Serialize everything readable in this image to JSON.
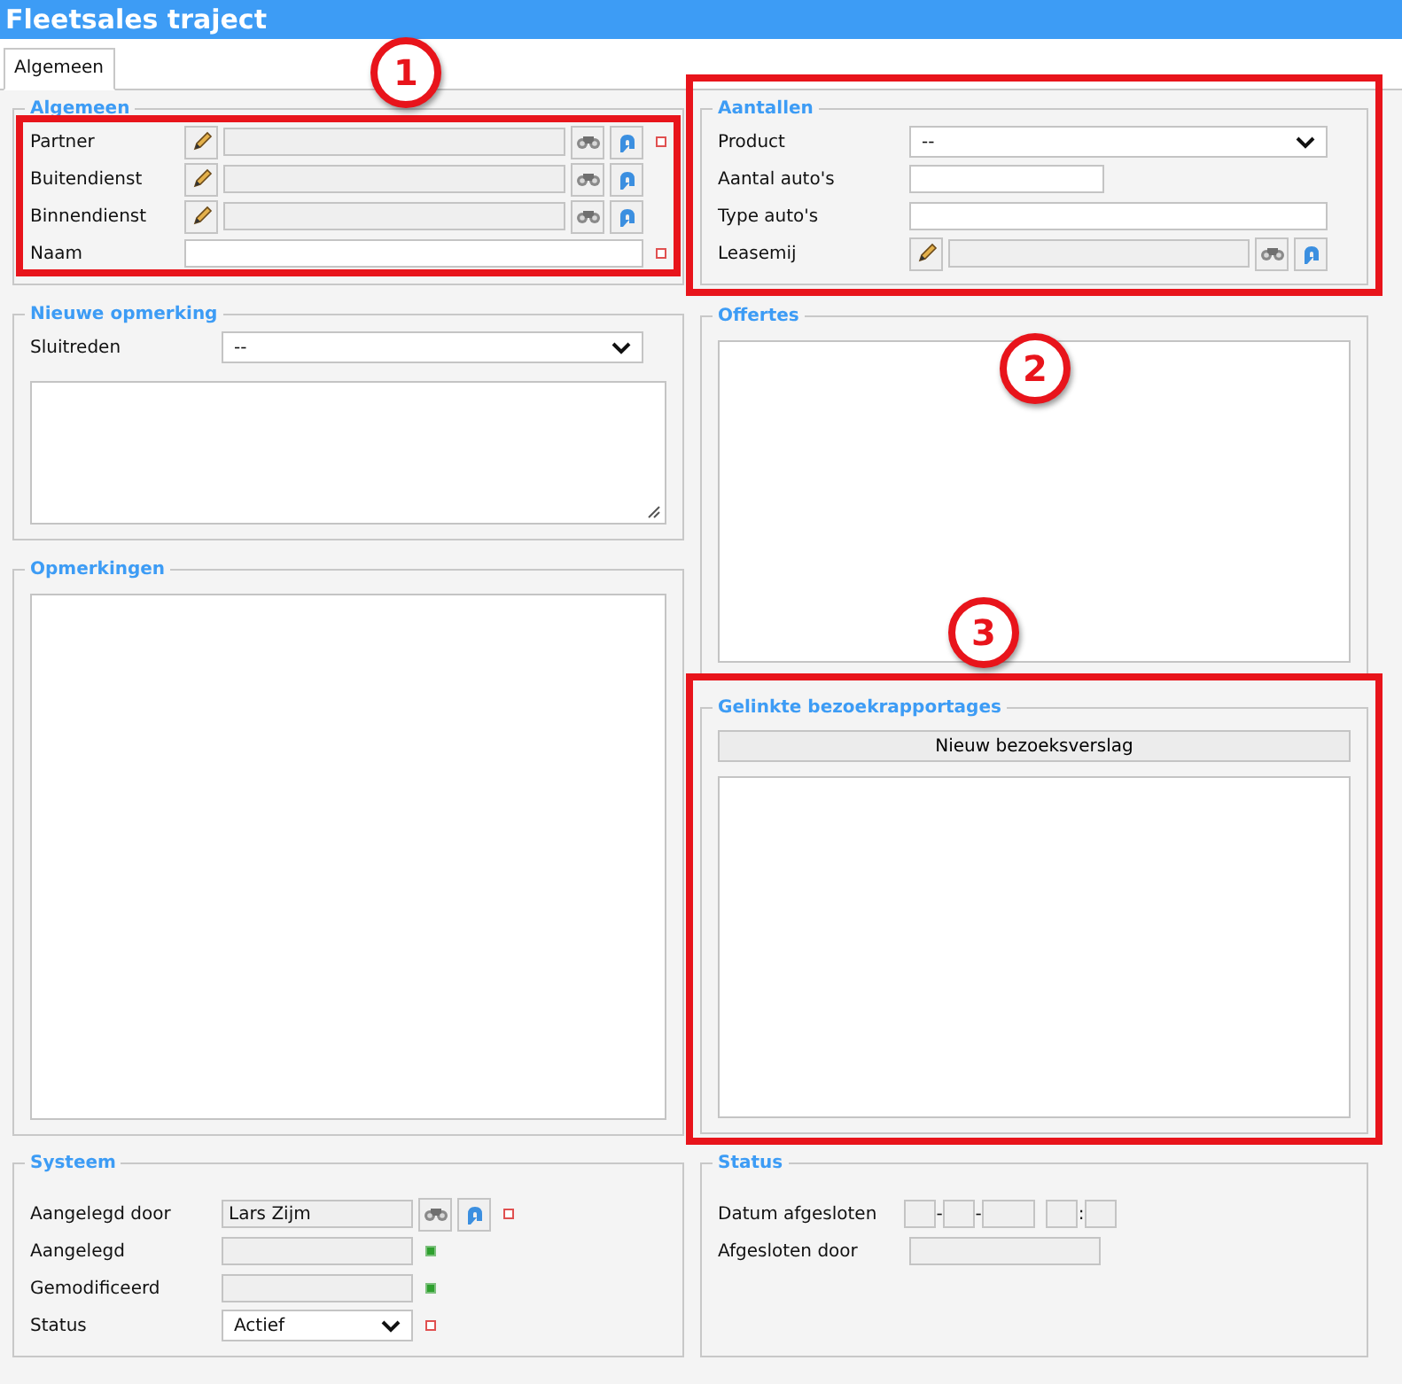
{
  "window": {
    "title": "Fleetsales traject"
  },
  "tabs": [
    {
      "label": "Algemeen",
      "selected": true
    }
  ],
  "left": [
    {
      "title": "Algemeen",
      "kind": "form",
      "rows_highlighted": true,
      "rows": [
        {
          "kind": "lookup",
          "label": "Partner",
          "required": true
        },
        {
          "kind": "lookup",
          "label": "Buitendienst"
        },
        {
          "kind": "lookup",
          "label": "Binnendienst"
        },
        {
          "kind": "text",
          "label": "Naam",
          "required": true
        }
      ]
    },
    {
      "title": "Nieuwe opmerking",
      "kind": "note",
      "rows": [
        {
          "kind": "select",
          "label": "Sluitreden",
          "value": "--"
        }
      ]
    },
    {
      "title": "Opmerkingen",
      "kind": "listbox"
    }
  ],
  "right": [
    {
      "title": "Aantallen",
      "kind": "form",
      "highlighted": true,
      "rows": [
        {
          "kind": "select",
          "label": "Product",
          "value": "--"
        },
        {
          "kind": "number",
          "label": "Aantal auto's"
        },
        {
          "kind": "text",
          "label": "Type auto's"
        },
        {
          "kind": "lookup",
          "label": "Leasemij"
        }
      ]
    },
    {
      "title": "Offertes",
      "kind": "listbox"
    },
    {
      "title": "Gelinkte bezoekrapportages",
      "kind": "listbox",
      "highlighted": true,
      "button": "Nieuw bezoeksverslag"
    }
  ],
  "bottom": [
    {
      "title": "Systeem",
      "kind": "compact",
      "rows": [
        {
          "kind": "search",
          "label": "Aangelegd door",
          "value": "Lars Zijm",
          "required": true
        },
        {
          "kind": "readonly",
          "label": "Aangelegd",
          "valid": true
        },
        {
          "kind": "readonly",
          "label": "Gemodificeerd",
          "valid": true
        },
        {
          "kind": "select",
          "label": "Status",
          "value": "Actief",
          "required": true
        }
      ]
    },
    {
      "title": "Status",
      "kind": "compact",
      "rows": [
        {
          "kind": "datetime",
          "label": "Datum afgesloten",
          "separators": [
            "-",
            "-",
            ":"
          ]
        },
        {
          "kind": "readonly",
          "label": "Afgesloten door"
        }
      ]
    }
  ],
  "callouts": [
    {
      "label": "1"
    },
    {
      "label": "2"
    },
    {
      "label": "3"
    }
  ]
}
